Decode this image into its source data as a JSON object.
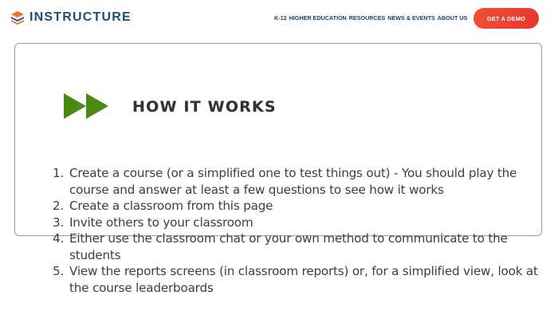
{
  "header": {
    "logo_text": "INSTRUCTURE",
    "nav": [
      "K-12",
      "HIGHER EDUCATION",
      "RESOURCES",
      "NEWS & EVENTS",
      "ABOUT US"
    ],
    "demo_label": "GET A DEMO"
  },
  "main": {
    "heading": "HOW IT WORKS",
    "steps": [
      {
        "num": "1.",
        "text": "Create a course (or a simplified one to test things out) - You should play the course and answer at least a few questions to see how it works"
      },
      {
        "num": "2.",
        "text": "Create a classroom from this page"
      },
      {
        "num": "3.",
        "text": "Invite others to your classroom"
      },
      {
        "num": "4.",
        "text": "Either use the classroom chat or your own method to communicate to the students"
      },
      {
        "num": "5.",
        "text": "View the reports screens (in classroom reports) or, for a simplified view, look at the course leaderboards"
      }
    ]
  },
  "colors": {
    "brand": "#1e4f72",
    "accent": "#e8362f",
    "icon_green": "#4b8a12"
  },
  "icons": [
    "instructure-logo-icon",
    "fast-forward-icon"
  ]
}
